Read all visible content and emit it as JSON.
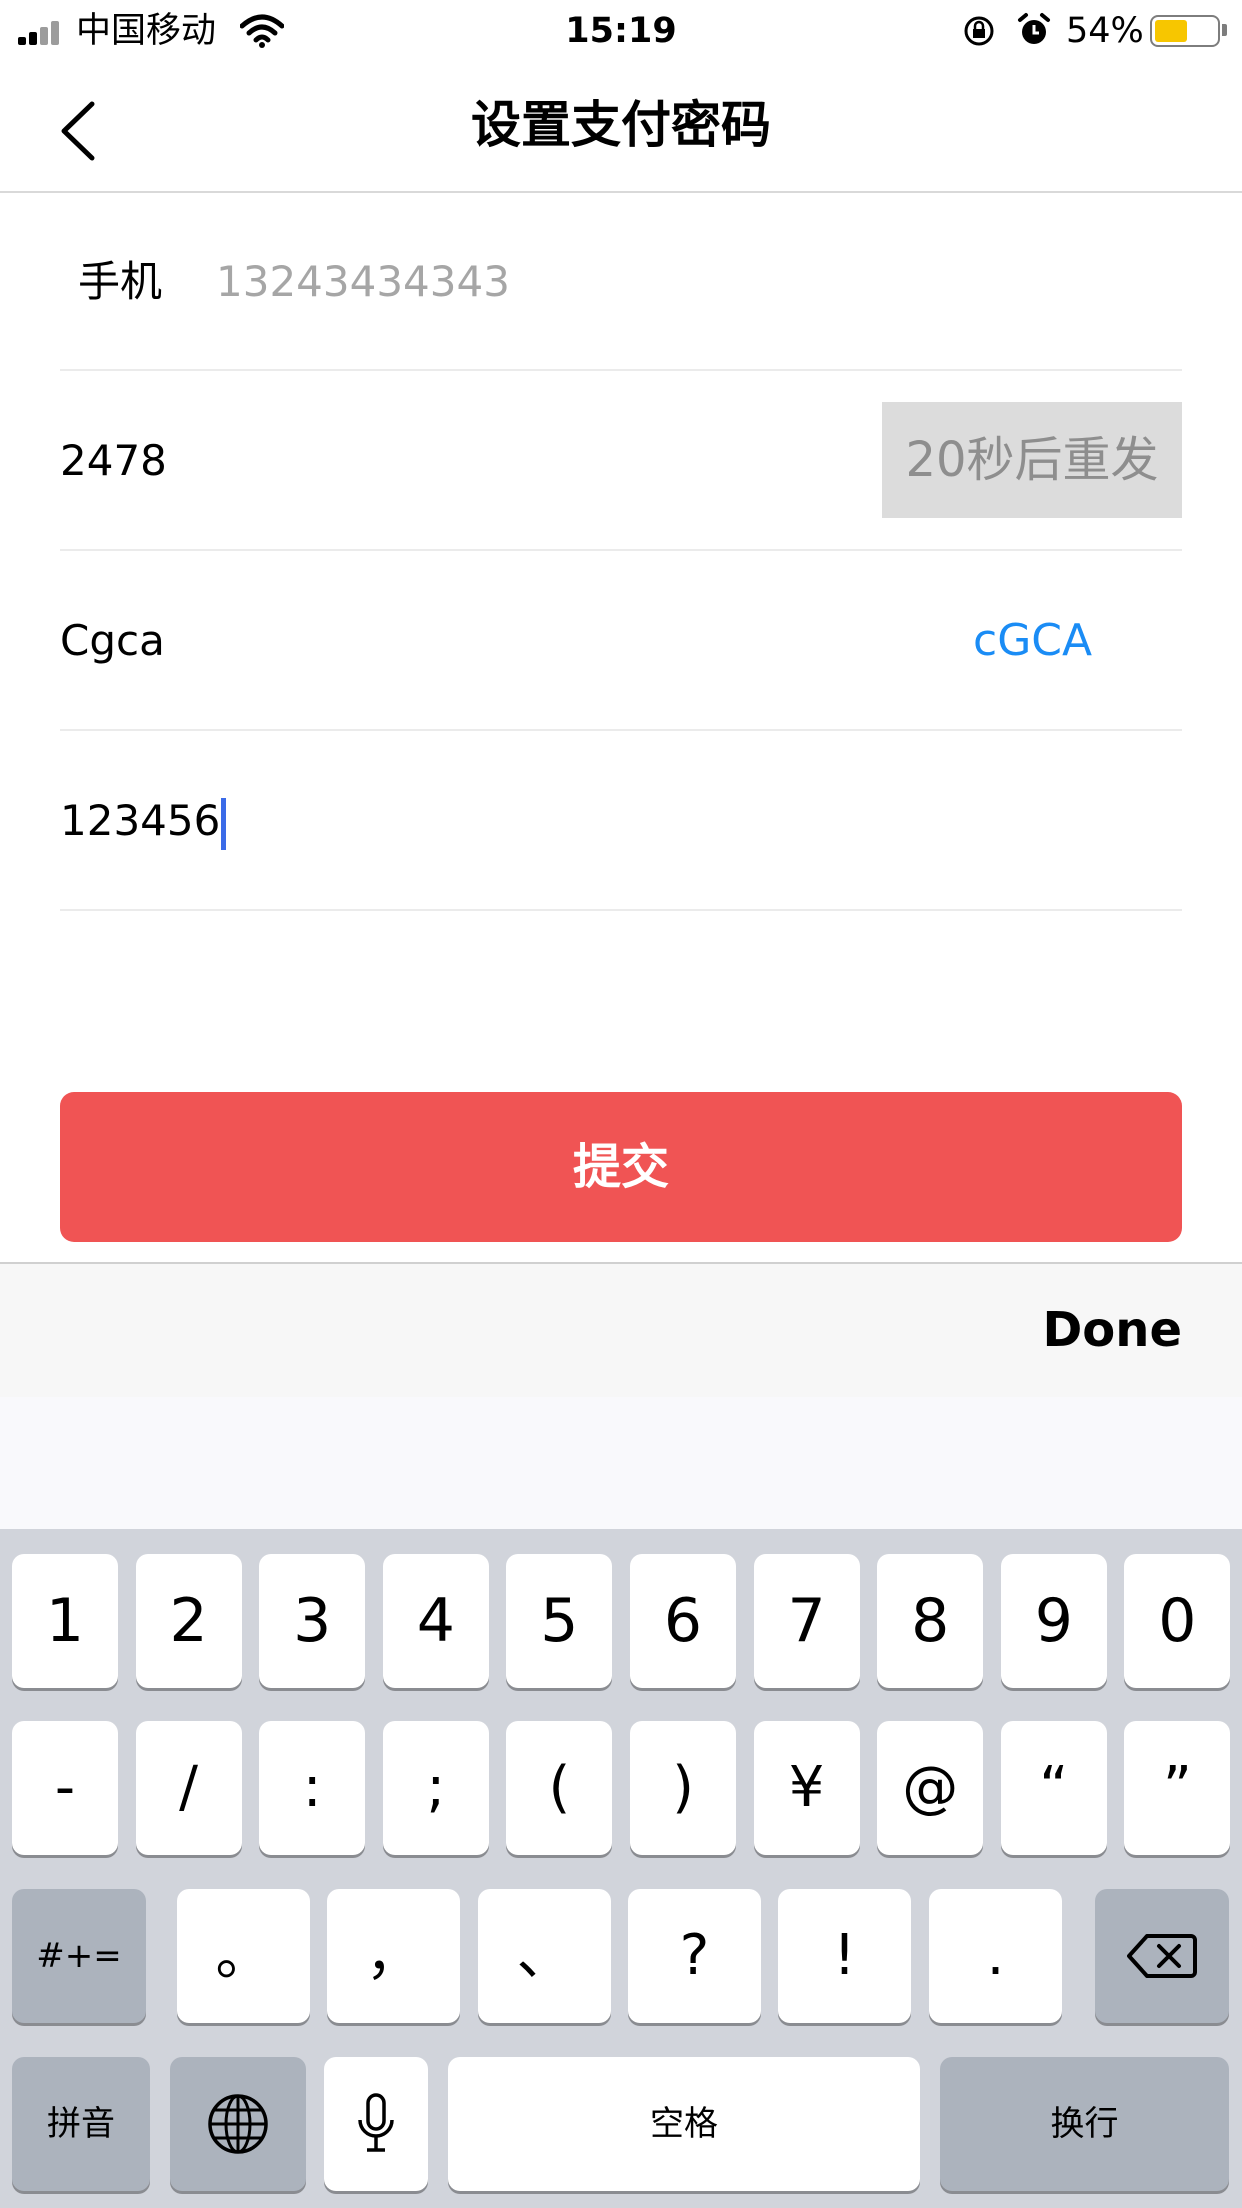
{
  "status_bar": {
    "carrier": "中国移动",
    "time": "15:19",
    "battery_percent": "54%",
    "battery_level": 0.54,
    "icons": [
      "signal-icon",
      "wifi-icon",
      "orientation-lock-icon",
      "alarm-icon",
      "battery-icon"
    ]
  },
  "nav": {
    "title": "设置支付密码",
    "back_icon": "chevron-left-icon"
  },
  "form": {
    "phone_label": "手机",
    "phone_value": "13243434343",
    "sms_code_value": "2478",
    "resend_label": "20秒后重发",
    "captcha_input_value": "Cgca",
    "captcha_text": "cGCA",
    "password_value": "123456"
  },
  "submit_label": "提交",
  "keyboard": {
    "done_label": "Done",
    "row1": [
      "1",
      "2",
      "3",
      "4",
      "5",
      "6",
      "7",
      "8",
      "9",
      "0"
    ],
    "row2": [
      "-",
      "/",
      ":",
      ";",
      "(",
      ")",
      "¥",
      "@",
      "“",
      "”"
    ],
    "row3_left": "#+=",
    "row3": [
      "。",
      "，",
      "、",
      "?",
      "!",
      "."
    ],
    "row4_pinyin": "拼音",
    "row4_space": "空格",
    "row4_return": "换行",
    "icons": [
      "delete-icon",
      "globe-icon",
      "microphone-icon"
    ]
  },
  "colors": {
    "accent_red": "#f05454",
    "captcha_blue": "#1a8cf5",
    "caret_blue": "#3b6be8",
    "battery_yellow": "#f7c600"
  }
}
